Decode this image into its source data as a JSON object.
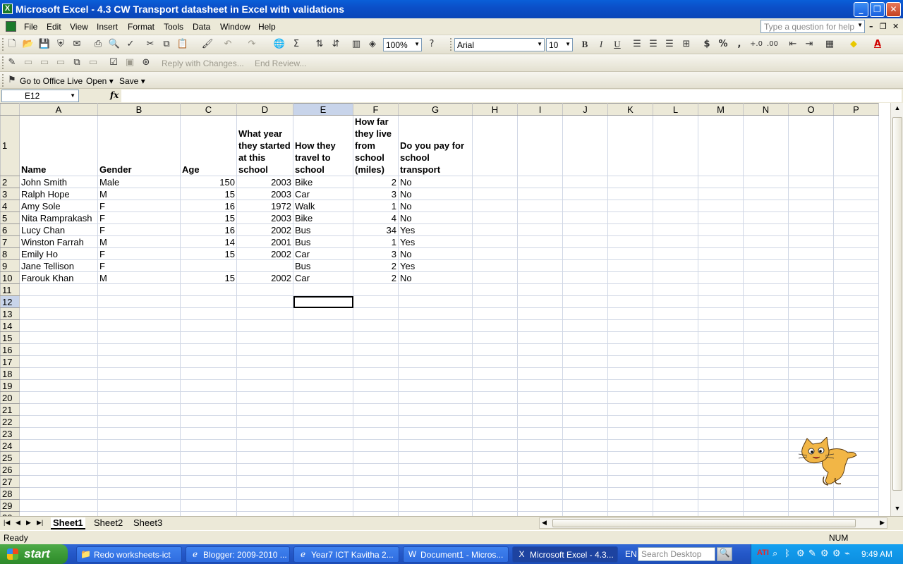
{
  "window": {
    "title": "Microsoft Excel - 4.3 CW Transport datasheet in Excel with validations",
    "minimize": "_",
    "restore": "❐",
    "close": "✕"
  },
  "menus": [
    "File",
    "Edit",
    "View",
    "Insert",
    "Format",
    "Tools",
    "Data",
    "Window",
    "Help"
  ],
  "help_box": {
    "placeholder": "Type a question for help"
  },
  "toolbar": {
    "zoom": "100%",
    "font_name": "Arial",
    "font_size": "10",
    "reply_with_changes": "Reply with Changes...",
    "end_review": "End Review...",
    "go_to_office_live": "Go to Office Live",
    "open": "Open",
    "save": "Save"
  },
  "formula_bar": {
    "name_box": "E12",
    "fx": "fx",
    "value": ""
  },
  "columns": [
    "A",
    "B",
    "C",
    "D",
    "E",
    "F",
    "G",
    "H",
    "I",
    "J",
    "K",
    "L",
    "M",
    "N",
    "O",
    "P"
  ],
  "selected_column": "E",
  "selected_row": 12,
  "sheet": {
    "headers": [
      "Name",
      "Gender",
      "Age",
      "What year they started at this school",
      "How they travel to school",
      "How far they live from school (miles)",
      "Do you pay for school transport"
    ],
    "rows": [
      [
        "John Smith",
        "Male",
        "150",
        "2003",
        "Bike",
        "2",
        "No"
      ],
      [
        "Ralph Hope",
        "M",
        "15",
        "2003",
        "Car",
        "3",
        "No"
      ],
      [
        "Amy Sole",
        "F",
        "16",
        "1972",
        "Walk",
        "1",
        "No"
      ],
      [
        "Nita Ramprakash",
        "F",
        "15",
        "2003",
        "Bike",
        "4",
        "No"
      ],
      [
        "Lucy Chan",
        "F",
        "16",
        "2002",
        "Bus",
        "34",
        "Yes"
      ],
      [
        "Winston Farrah",
        "M",
        "14",
        "2001",
        "Bus",
        "1",
        "Yes"
      ],
      [
        "Emily Ho",
        "F",
        "15",
        "2002",
        "Car",
        "3",
        "No"
      ],
      [
        "Jane Tellison",
        "F",
        "",
        "",
        "Bus",
        "2",
        "Yes"
      ],
      [
        "Farouk Khan",
        "M",
        "15",
        "2002",
        "Car",
        "2",
        "No"
      ]
    ],
    "total_rows_visible": 30
  },
  "sheet_tabs": [
    "Sheet1",
    "Sheet2",
    "Sheet3"
  ],
  "active_sheet": "Sheet1",
  "status": {
    "left": "Ready",
    "num": "NUM"
  },
  "taskbar": {
    "start": "start",
    "tasks": [
      "Redo worksheets-ict",
      "Blogger: 2009-2010 ...",
      "Year7 ICT Kavitha 2...",
      "Document1 - Micros...",
      "Microsoft Excel - 4.3..."
    ],
    "language": "EN",
    "search_placeholder": "Search Desktop",
    "clock": "9:49 AM"
  }
}
